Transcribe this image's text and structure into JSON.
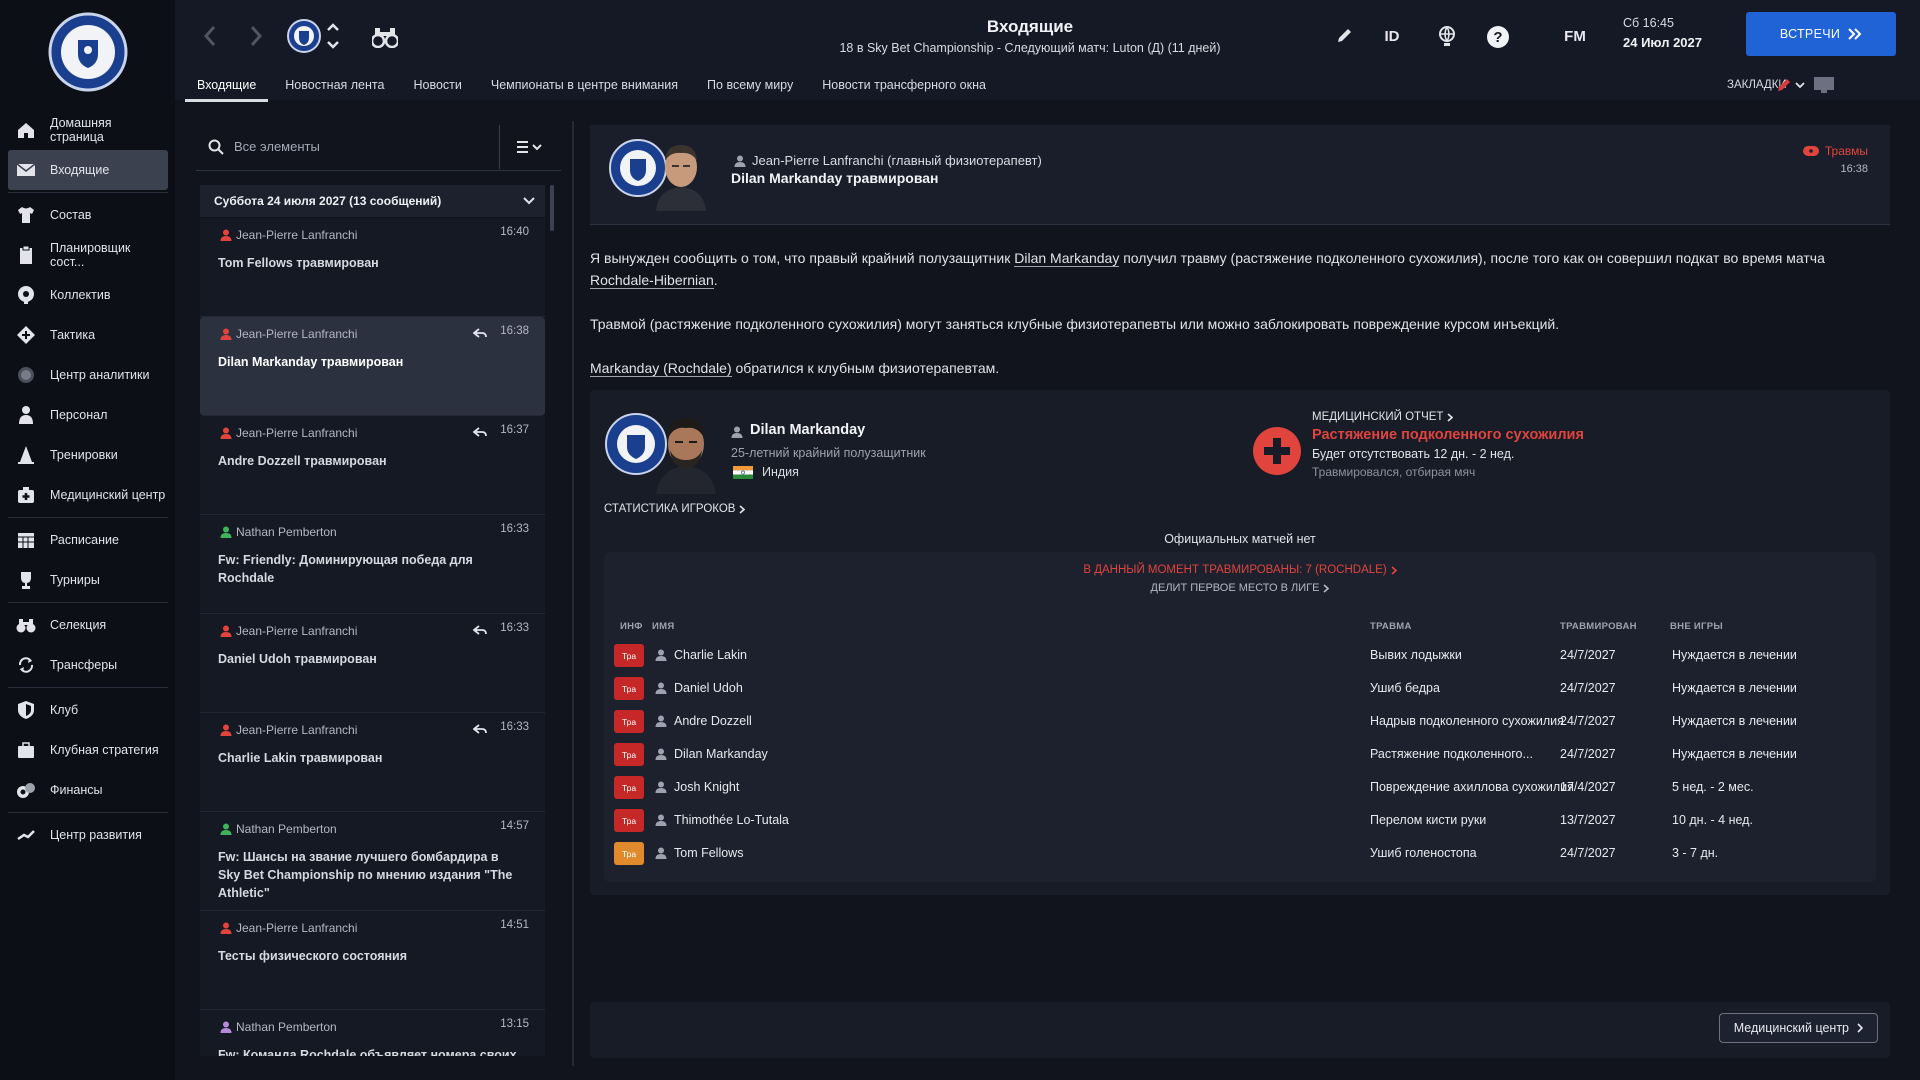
{
  "sidebar": {
    "items": [
      {
        "label": "Домашняя страница",
        "icon": "home-icon"
      },
      {
        "label": "Входящие",
        "icon": "inbox-icon",
        "active": true
      },
      {
        "label": "Состав",
        "icon": "shirt-icon"
      },
      {
        "label": "Планировщик сост...",
        "icon": "clipboard-icon"
      },
      {
        "label": "Коллектив",
        "icon": "team-icon"
      },
      {
        "label": "Тактика",
        "icon": "tactics-icon"
      },
      {
        "label": "Центр аналитики",
        "icon": "analytics-icon"
      },
      {
        "label": "Персонал",
        "icon": "staff-icon"
      },
      {
        "label": "Тренировки",
        "icon": "training-cone-icon"
      },
      {
        "label": "Медицинский центр",
        "icon": "medical-kit-icon"
      },
      {
        "label": "Расписание",
        "icon": "calendar-icon"
      },
      {
        "label": "Турниры",
        "icon": "trophy-icon"
      },
      {
        "label": "Селекция",
        "icon": "binoculars-icon"
      },
      {
        "label": "Трансферы",
        "icon": "transfer-icon"
      },
      {
        "label": "Клуб",
        "icon": "shield-icon"
      },
      {
        "label": "Клубная стратегия",
        "icon": "briefcase-icon"
      },
      {
        "label": "Финансы",
        "icon": "finance-icon"
      },
      {
        "label": "Центр развития",
        "icon": "development-icon"
      }
    ]
  },
  "header": {
    "title": "Входящие",
    "subtitle": "18 в Sky Bet Championship - Следующий матч: Luton (Д) (11 дней)",
    "id_label": "ID",
    "fm_label": "FM",
    "time_label": "Сб 16:45",
    "date_label": "24 Июл 2027",
    "meetings_label": "ВСТРЕЧИ",
    "bookmarks_label": "ЗАКЛАДКИ",
    "tabs": [
      "Входящие",
      "Новостная лента",
      "Новости",
      "Чемпионаты в центре внимания",
      "По всему миру",
      "Новости трансферного окна"
    ]
  },
  "list": {
    "search_placeholder": "Все элементы",
    "group_label": "Суббота 24 июля 2027 (13 сообщений)",
    "messages": [
      {
        "sender": "Jean-Pierre Lanfranchi",
        "time": "16:40",
        "subject": "Tom Fellows травмирован",
        "sender_color": "#e0443d",
        "replied": false
      },
      {
        "sender": "Jean-Pierre Lanfranchi",
        "time": "16:38",
        "subject": "Dilan Markanday травмирован",
        "sender_color": "#e0443d",
        "replied": true,
        "selected": true
      },
      {
        "sender": "Jean-Pierre Lanfranchi",
        "time": "16:37",
        "subject": "Andre Dozzell травмирован",
        "sender_color": "#e0443d",
        "replied": true
      },
      {
        "sender": "Nathan Pemberton",
        "time": "16:33",
        "subject": "Fw: Friendly: Доминирующая победа для Rochdale",
        "sender_color": "#3fb35a",
        "replied": false
      },
      {
        "sender": "Jean-Pierre Lanfranchi",
        "time": "16:33",
        "subject": "Daniel Udoh травмирован",
        "sender_color": "#e0443d",
        "replied": true
      },
      {
        "sender": "Jean-Pierre Lanfranchi",
        "time": "16:33",
        "subject": "Charlie Lakin травмирован",
        "sender_color": "#e0443d",
        "replied": true
      },
      {
        "sender": "Nathan Pemberton",
        "time": "14:57",
        "subject": "Fw: Шансы на звание лучшего бомбардира в Sky Bet Championship по мнению издания \"The Athletic\"",
        "sender_color": "#3fb35a",
        "replied": false
      },
      {
        "sender": "Jean-Pierre Lanfranchi",
        "time": "14:51",
        "subject": "Тесты физического состояния",
        "sender_color": "#e0443d",
        "replied": false
      },
      {
        "sender": "Nathan Pemberton",
        "time": "13:15",
        "subject": "Fw: Команда Rochdale объявляет номера своих",
        "sender_color": "#b58ad6",
        "replied": false
      }
    ]
  },
  "detail": {
    "sender": "Jean-Pierre Lanfranchi  (главный физиотерапевт)",
    "subject": "Dilan Markanday травмирован",
    "tag": "Травмы",
    "time": "16:38",
    "para1_a": "Я вынужден сообщить о том, что правый крайний полузащитник ",
    "para1_link1": "Dilan Markanday",
    "para1_b": " получил травму (растяжение подколенного сухожилия), после того как он совершил подкат во время матча ",
    "para1_link2": "Rochdale-Hibernian",
    "para1_c": ".",
    "para2": "Травмой (растяжение подколенного сухожилия) могут заняться клубные физиотерапевты или можно заблокировать повреждение курсом инъекций.",
    "para3_link": "Markanday (Rochdale)",
    "para3_b": " обратился к клубным физиотерапевтам.",
    "player": {
      "name": "Dilan Markanday",
      "description": "25-летний крайний полузащитник",
      "nation": "Индия",
      "med_report_label": "МЕДИЦИНСКИЙ ОТЧЕТ",
      "injury": "Растяжение подколенного сухожилия",
      "out_for": "Будет отсутствовать 12 дн. - 2 нед.",
      "cause": "Травмировался, отбирая мяч",
      "stats_link": "СТАТИСТИКА ИГРОКОВ",
      "no_matches": "Официальных матчей нет"
    },
    "injuries": {
      "title": "В ДАННЫЙ МОМЕНТ ТРАВМИРОВАНЫ: 7 (ROCHDALE)",
      "subtitle": "ДЕЛИТ ПЕРВОЕ МЕСТО В ЛИГЕ",
      "headers": {
        "info": "ИНФ",
        "name": "ИМЯ",
        "injury": "ТРАВМА",
        "injured": "ТРАВМИРОВАН",
        "out": "ВНЕ ИГРЫ"
      },
      "rows": [
        {
          "badge": "Тра",
          "badge_color": "#c62828",
          "name": "Charlie Lakin",
          "injury": "Вывих лодыжки",
          "date": "24/7/2027",
          "out": "Нуждается в лечении"
        },
        {
          "badge": "Тра",
          "badge_color": "#c62828",
          "name": "Daniel Udoh",
          "injury": "Ушиб бедра",
          "date": "24/7/2027",
          "out": "Нуждается в лечении"
        },
        {
          "badge": "Тра",
          "badge_color": "#c62828",
          "name": "Andre Dozzell",
          "injury": "Надрыв подколенного сухожилия",
          "date": "24/7/2027",
          "out": "Нуждается в лечении"
        },
        {
          "badge": "Тра",
          "badge_color": "#c62828",
          "name": "Dilan Markanday",
          "injury": "Растяжение подколенного...",
          "date": "24/7/2027",
          "out": "Нуждается в лечении"
        },
        {
          "badge": "Тра",
          "badge_color": "#c62828",
          "name": "Josh Knight",
          "injury": "Повреждение ахиллова сухожилия",
          "date": "17/4/2027",
          "out": "5 нед. - 2 мес."
        },
        {
          "badge": "Тра",
          "badge_color": "#c62828",
          "name": "Thimothée Lo-Tutala",
          "injury": "Перелом кисти руки",
          "date": "13/7/2027",
          "out": "10 дн. - 4 нед."
        },
        {
          "badge": "Тра",
          "badge_color": "#e08a2c",
          "name": "Tom Fellows",
          "injury": "Ушиб голеностопа",
          "date": "24/7/2027",
          "out": "3 - 7 дн."
        }
      ]
    },
    "medical_centre_button": "Медицинский центр"
  },
  "colors": {
    "accent": "#1f63d6",
    "injury_red": "#e0443d"
  }
}
